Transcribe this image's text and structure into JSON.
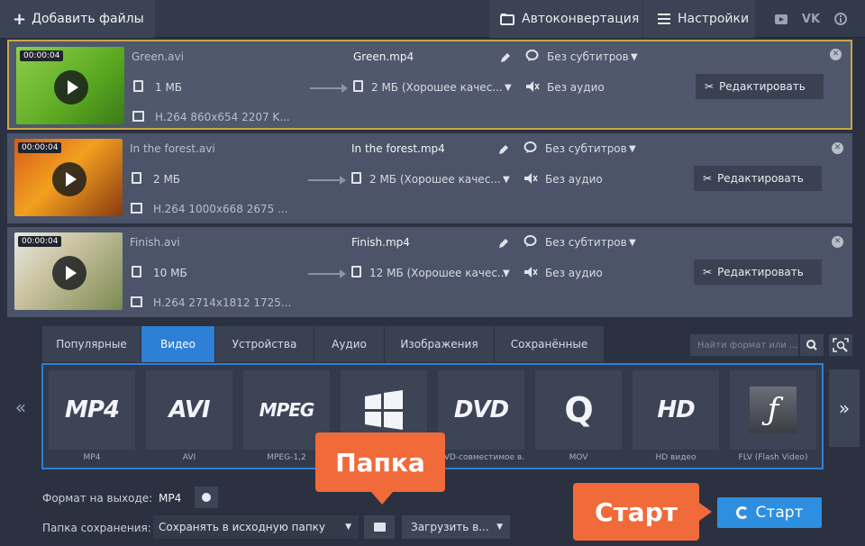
{
  "topbar": {
    "add_files": "Добавить файлы",
    "autoconvert": "Автоконвертация",
    "settings": "Настройки",
    "social": [
      "youtube-icon",
      "vk-icon",
      "info-icon"
    ],
    "vk_text": "VK"
  },
  "files": [
    {
      "timecode": "00:00:04",
      "src_name": "Green.avi",
      "src_size": "1 МБ",
      "src_codec": "H.264 860x654 2207 K...",
      "out_name": "Green.mp4",
      "out_size": "2 МБ (Хорошее качес...",
      "subtitles": "Без субтитров",
      "audio": "Без аудио",
      "edit": "Редактировать",
      "selected": true
    },
    {
      "timecode": "00:00:04",
      "src_name": "In the forest.avi",
      "src_size": "2 МБ",
      "src_codec": "H.264 1000x668 2675 ...",
      "out_name": "In the forest.mp4",
      "out_size": "2 МБ (Хорошее качес...",
      "subtitles": "Без субтитров",
      "audio": "Без аудио",
      "edit": "Редактировать",
      "selected": false
    },
    {
      "timecode": "00:00:04",
      "src_name": "Finish.avi",
      "src_size": "10 МБ",
      "src_codec": "H.264 2714x1812 1725...",
      "out_name": "Finish.mp4",
      "out_size": "12 МБ (Хорошее качес...",
      "subtitles": "Без субтитров",
      "audio": "Без аудио",
      "edit": "Редактировать",
      "selected": false
    }
  ],
  "tabs": [
    "Популярные",
    "Видео",
    "Устройства",
    "Аудио",
    "Изображения",
    "Сохранённые"
  ],
  "active_tab": "Видео",
  "search_placeholder": "Найти формат или ...",
  "formats": [
    {
      "logo": "MP4",
      "name": "MP4"
    },
    {
      "logo": "AVI",
      "name": "AVI"
    },
    {
      "logo": "MPEG",
      "name": "MPEG-1,2"
    },
    {
      "logo": "windows-logo-icon",
      "name": ""
    },
    {
      "logo": "DVD",
      "name": "DVD-совместимое в..."
    },
    {
      "logo": "Q",
      "name": "MOV"
    },
    {
      "logo": "HD",
      "name": "HD видео"
    },
    {
      "logo": "flash-logo-icon",
      "name": "FLV (Flash Video)"
    }
  ],
  "bottom": {
    "output_format_label": "Формат на выходе:",
    "output_format_value": "MP4",
    "save_folder_label": "Папка сохранения:",
    "save_folder_value": "Сохранять в исходную папку",
    "upload": "Загрузить в...",
    "start": "Старт"
  },
  "callouts": {
    "folder": "Папка",
    "start": "Старт"
  },
  "colors": {
    "accent": "#2e8ee0",
    "callout": "#f06a3a",
    "selection": "#caa64a"
  }
}
